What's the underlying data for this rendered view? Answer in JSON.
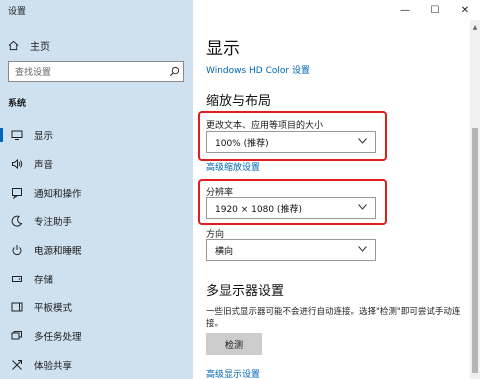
{
  "window": {
    "title": "设置",
    "controls": [
      "—",
      "☐",
      "✕"
    ]
  },
  "sidebar": {
    "home_label": "主页",
    "search_placeholder": "查找设置",
    "section_label": "系统",
    "items": [
      {
        "label": "显示",
        "icon": "monitor-icon",
        "active": true
      },
      {
        "label": "声音",
        "icon": "speaker-icon"
      },
      {
        "label": "通知和操作",
        "icon": "notification-icon"
      },
      {
        "label": "专注助手",
        "icon": "moon-icon"
      },
      {
        "label": "电源和睡眠",
        "icon": "power-icon"
      },
      {
        "label": "存储",
        "icon": "storage-icon"
      },
      {
        "label": "平板模式",
        "icon": "tablet-icon"
      },
      {
        "label": "多任务处理",
        "icon": "multitask-icon"
      },
      {
        "label": "体验共享",
        "icon": "share-icon"
      }
    ]
  },
  "main": {
    "title": "显示",
    "hd_color_link": "Windows HD Color 设置",
    "scale_heading": "缩放与布局",
    "scale_label": "更改文本、应用等项目的大小",
    "scale_value": "100% (推荐)",
    "advanced_scale_link": "高级缩放设置",
    "resolution_label": "分辨率",
    "resolution_value": "1920 × 1080 (推荐)",
    "orientation_label": "方向",
    "orientation_value": "横向",
    "multi_heading": "多显示器设置",
    "multi_desc": "一些旧式显示器可能不会进行自动连接。选择\"检测\"即可尝试手动连接。",
    "detect_button": "检测",
    "advanced_display_link": "高级显示设置"
  },
  "colors": {
    "sidebar_bg": "#cfe0ee",
    "accent": "#0066b4",
    "highlight": "#e01e1e"
  }
}
